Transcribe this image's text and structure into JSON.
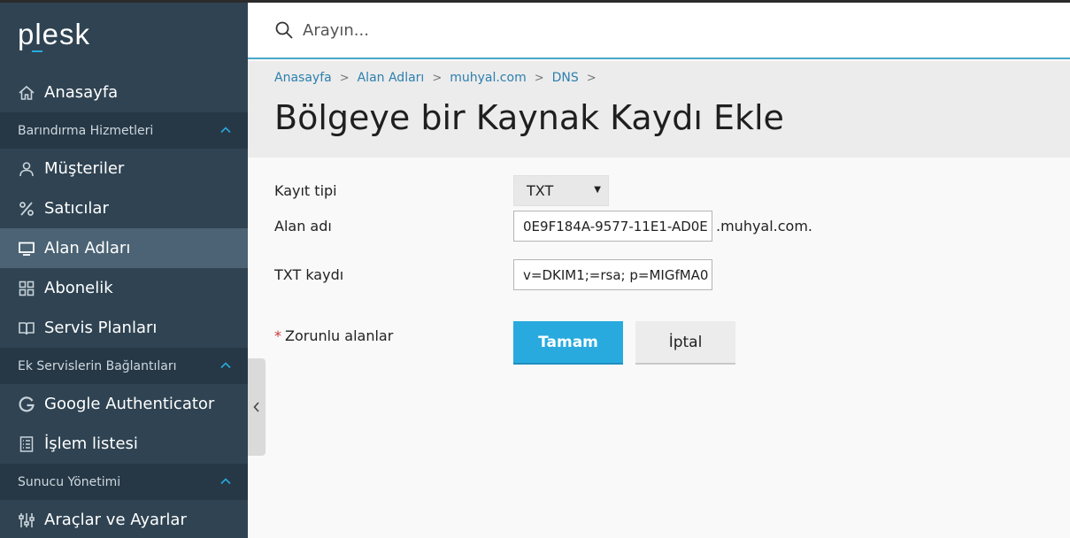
{
  "brand": {
    "logo": "plesk",
    "accent": "#28aade"
  },
  "search": {
    "placeholder": "Arayın..."
  },
  "sidebar": {
    "items": [
      {
        "label": "Anasayfa",
        "icon": "home-icon"
      },
      {
        "label": "Müşteriler",
        "icon": "user-icon"
      },
      {
        "label": "Satıcılar",
        "icon": "percent-icon"
      },
      {
        "label": "Alan Adları",
        "icon": "monitor-icon",
        "active": true
      },
      {
        "label": "Abonelik",
        "icon": "grid-icon"
      },
      {
        "label": "Servis Planları",
        "icon": "book-icon"
      },
      {
        "label": "Google Authenticator",
        "icon": "google-icon"
      },
      {
        "label": "İşlem listesi",
        "icon": "list-icon"
      },
      {
        "label": "Araçlar ve Ayarlar",
        "icon": "sliders-icon"
      }
    ],
    "groups": [
      {
        "label": "Barındırma Hizmetleri"
      },
      {
        "label": "Ek Servislerin Bağlantıları"
      },
      {
        "label": "Sunucu Yönetimi"
      }
    ]
  },
  "breadcrumb": [
    "Anasayfa",
    "Alan Adları",
    "muhyal.com",
    "DNS"
  ],
  "page": {
    "title": "Bölgeye bir Kaynak Kaydı Ekle"
  },
  "form": {
    "record_type_label": "Kayıt tipi",
    "record_type_value": "TXT",
    "domain_label": "Alan adı",
    "domain_value": "0E9F184A-9577-11E1-AD0E",
    "domain_suffix": ".muhyal.com.",
    "txt_label": "TXT kaydı",
    "txt_value": "v=DKIM1;=rsa; p=MIGfMA0",
    "required_star": "*",
    "required_label": "Zorunlu alanlar",
    "ok_label": "Tamam",
    "cancel_label": "İptal"
  }
}
